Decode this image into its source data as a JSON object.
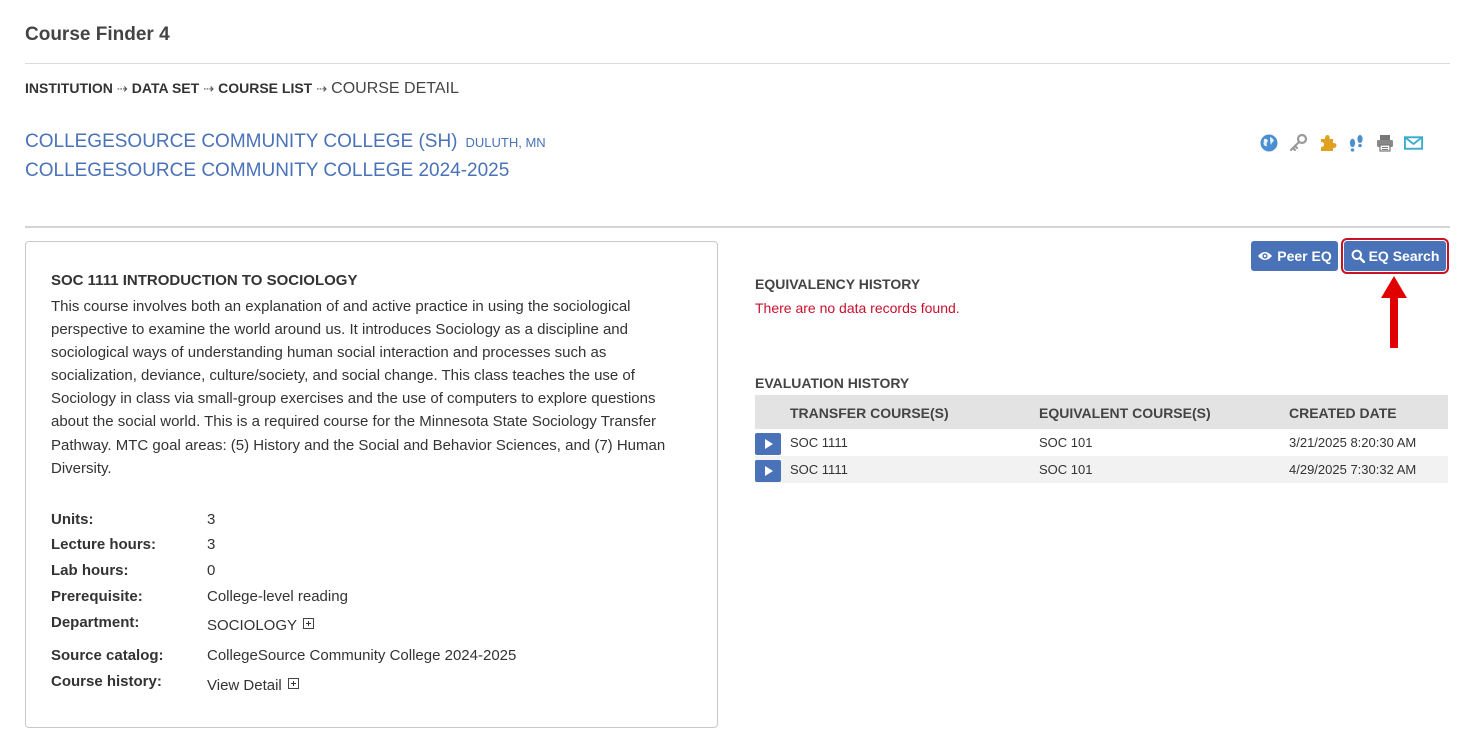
{
  "app": {
    "title": "Course Finder 4"
  },
  "breadcrumb": {
    "items": [
      "INSTITUTION",
      "DATA SET",
      "COURSE LIST"
    ],
    "current": "COURSE DETAIL",
    "separator": "⇢"
  },
  "institution": {
    "name": "COLLEGESOURCE COMMUNITY COLLEGE (SH)",
    "location": "DULUTH, MN",
    "catalog": "COLLEGESOURCE COMMUNITY COLLEGE 2024-2025"
  },
  "toolbar_icons": [
    "globe-icon",
    "key-icon",
    "puzzle-icon",
    "footprints-icon",
    "printer-icon",
    "mail-icon"
  ],
  "course": {
    "title": "SOC 1111 INTRODUCTION TO SOCIOLOGY",
    "description": "This course involves both an explanation of and active practice in using the sociological perspective to examine the world around us. It introduces Sociology as a discipline and sociological ways of understanding human social interaction and processes such as socialization, deviance, culture/society, and social change. This class teaches the use of Sociology in class via small-group exercises and the use of computers to explore questions about the social world. This is a required course for the Minnesota State Sociology Transfer Pathway. MTC goal areas: (5) History and the Social and Behavior Sciences, and (7) Human Diversity.",
    "attributes": {
      "units": {
        "label": "Units:",
        "value": "3"
      },
      "lecture": {
        "label": "Lecture hours:",
        "value": "3"
      },
      "lab": {
        "label": "Lab hours:",
        "value": "0"
      },
      "prereq": {
        "label": "Prerequisite:",
        "value": "College-level reading"
      },
      "department": {
        "label": "Department:",
        "value": "SOCIOLOGY"
      },
      "source": {
        "label": "Source catalog:",
        "value": "CollegeSource Community College 2024-2025"
      },
      "history": {
        "label": "Course history:",
        "value": "View Detail"
      }
    }
  },
  "buttons": {
    "peer_eq": "Peer EQ",
    "eq_search": "EQ Search"
  },
  "equivalency": {
    "heading": "EQUIVALENCY HISTORY",
    "empty_message": "There are no data records found."
  },
  "evaluation": {
    "heading": "EVALUATION HISTORY",
    "columns": [
      "TRANSFER COURSE(S)",
      "EQUIVALENT COURSE(S)",
      "CREATED DATE"
    ],
    "rows": [
      {
        "transfer": "SOC 1111",
        "equivalent": "SOC 101",
        "created": "3/21/2025 8:20:30 AM"
      },
      {
        "transfer": "SOC 1111",
        "equivalent": "SOC 101",
        "created": "4/29/2025 7:30:32 AM"
      }
    ]
  },
  "colors": {
    "accent": "#4a72b8",
    "highlight": "#cc1122",
    "error_text": "#c8102e",
    "annotation_arrow": "#e00000"
  }
}
